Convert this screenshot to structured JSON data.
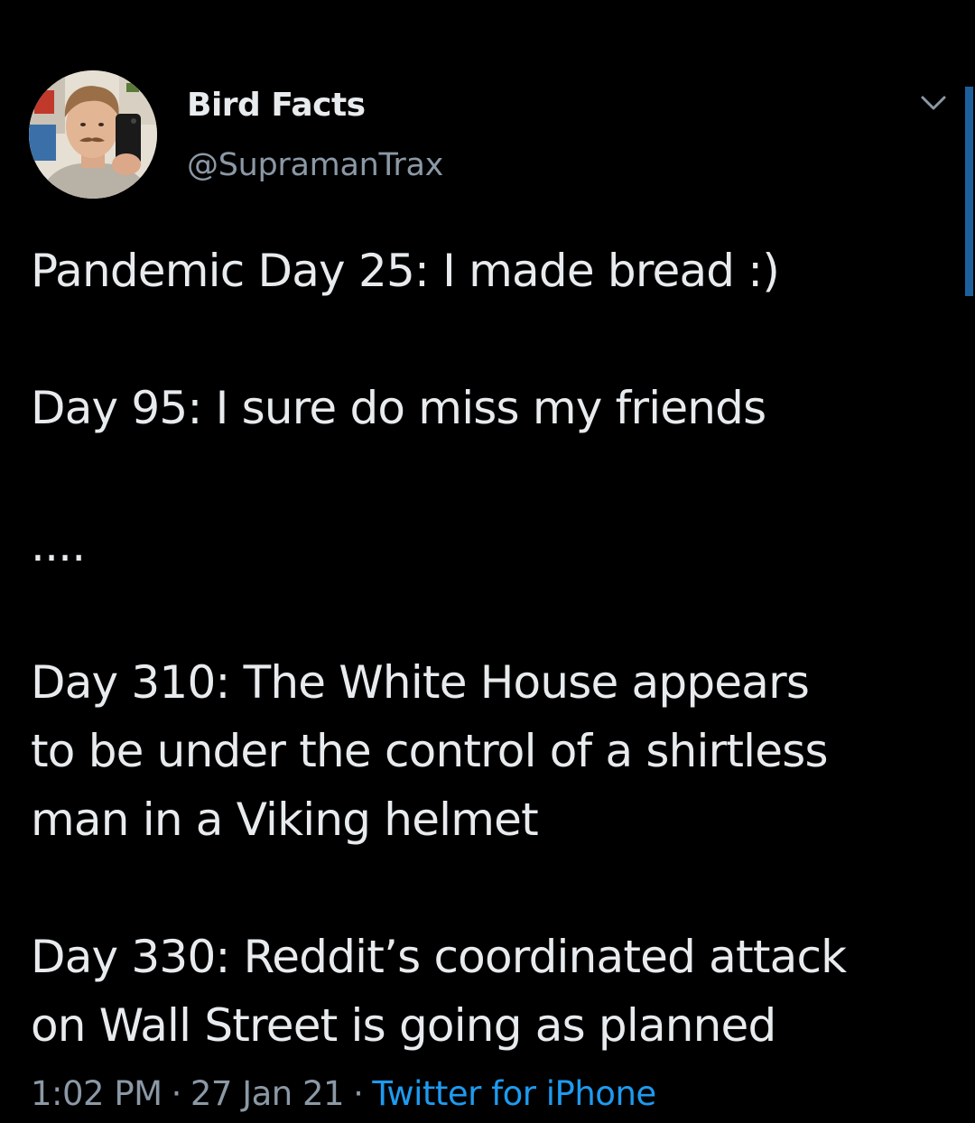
{
  "author": {
    "name": "Bird Facts",
    "handle": "@SupramanTrax"
  },
  "tweet": {
    "lines": [
      "Pandemic Day 25: I made bread :)",
      "",
      "Day 95: I sure do miss my friends",
      "",
      "....",
      "",
      "Day 310: The White House appears",
      "to be under the control of a shirtless",
      "man in a Viking helmet",
      "",
      "Day 330: Reddit’s coordinated attack",
      "on Wall Street is going as planned"
    ]
  },
  "meta": {
    "time": "1:02 PM",
    "date": "27 Jan 21",
    "separator": "·",
    "source": "Twitter for iPhone"
  },
  "colors": {
    "background": "#000000",
    "text": "#e8ebee",
    "secondary": "#8b98a5",
    "link": "#1d9bf0"
  },
  "icons": {
    "menu": "chevron-down-icon",
    "avatar": "profile-photo"
  }
}
